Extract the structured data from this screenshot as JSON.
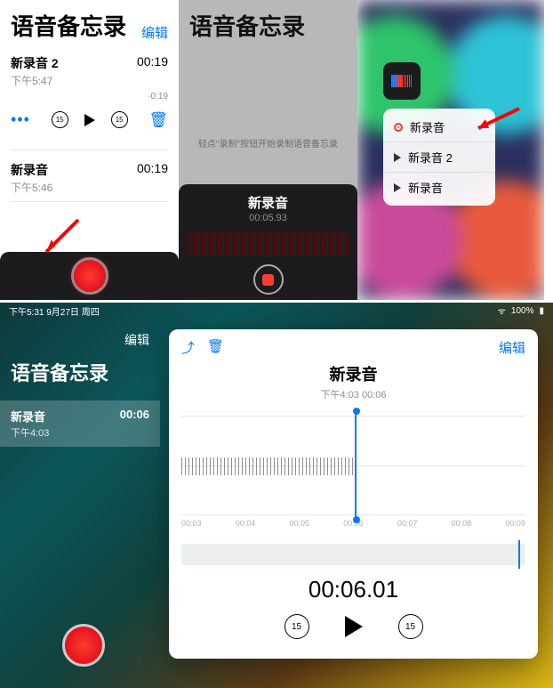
{
  "p1": {
    "title": "语音备忘录",
    "edit": "编辑",
    "row_selected": {
      "title": "新录音 2",
      "time": "下午5:47",
      "dur": "00:19",
      "remain": "-0:19"
    },
    "skip_back": "15",
    "skip_fwd": "15",
    "row2": {
      "title": "新录音",
      "time": "下午5:46",
      "dur": "00:19"
    }
  },
  "p2": {
    "title": "语音备忘录",
    "hint": "轻点\"录制\"按钮开始录制语音备忘录",
    "rec_title": "新录音",
    "rec_time": "00:05.93"
  },
  "p3": {
    "items": [
      {
        "label": "新录音"
      },
      {
        "label": "新录音 2"
      },
      {
        "label": "新录音"
      }
    ]
  },
  "p4": {
    "status": {
      "left": "下午5:31  9月27日 周四",
      "wifi": "100%"
    },
    "side": {
      "edit": "编辑",
      "title": "语音备忘录",
      "row": {
        "title": "新录音",
        "time": "下午4:03",
        "dur": "00:06"
      }
    },
    "card": {
      "edit": "编辑",
      "title": "新录音",
      "sub": "下午4:03  00:06",
      "ticks": [
        "00:03",
        "00:04",
        "00:05",
        "00:06",
        "00:07",
        "00:08",
        "00:09"
      ],
      "time": "00:06.01",
      "skip_back": "15",
      "skip_fwd": "15"
    }
  }
}
